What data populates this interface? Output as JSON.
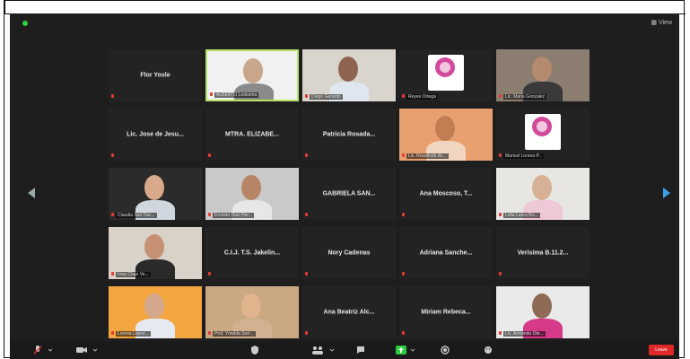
{
  "window": {
    "view_label": "View"
  },
  "nav": {
    "prev_label": "",
    "next_label": ""
  },
  "tiles": [
    {
      "name": "Flor Yosle",
      "label": "",
      "type": "name",
      "active": false
    },
    {
      "name": "",
      "label": "ALBERTO Ledesma",
      "type": "video",
      "active": true,
      "skin": "#c9a58a",
      "bg": "#f1f1f1",
      "shirt": "#8a8a8a"
    },
    {
      "name": "",
      "label": "Diego Gerardo",
      "type": "video",
      "active": false,
      "skin": "#8e6450",
      "bg": "#d9d4cc",
      "shirt": "#dfe6ef"
    },
    {
      "name": "",
      "label": "Reyes Ortega",
      "type": "logo",
      "active": false
    },
    {
      "name": "",
      "label": "Lic. Maria Gonzalez",
      "type": "video",
      "active": false,
      "skin": "#b58a6e",
      "bg": "#8c7d71",
      "shirt": "#3a3a3a"
    },
    {
      "name": "Lic. Jose de Jesu...",
      "label": "",
      "type": "name",
      "active": false
    },
    {
      "name": "MTRA. ELIZABE...",
      "label": "",
      "type": "name",
      "active": false
    },
    {
      "name": "Patricia Rosada...",
      "label": "",
      "type": "name",
      "active": false
    },
    {
      "name": "",
      "label": "Lic. Rosalinda de...",
      "type": "video",
      "active": false,
      "skin": "#c27d52",
      "bg": "#e9a070",
      "shirt": "#f0d6c0"
    },
    {
      "name": "",
      "label": "Maricel Lorena P...",
      "type": "logo",
      "active": false
    },
    {
      "name": "",
      "label": "Claudia San Osc...",
      "type": "video",
      "active": false,
      "skin": "#d8a98a",
      "bg": "#2b2b2b",
      "shirt": "#d1d7de"
    },
    {
      "name": "",
      "label": "Ernesto Diaz Her...",
      "type": "video",
      "active": false,
      "skin": "#b88466",
      "bg": "#c9c9c9",
      "shirt": "#e7e7e7"
    },
    {
      "name": "GABRIELA SAN...",
      "label": "",
      "type": "name",
      "active": false
    },
    {
      "name": "Ana Moscoso, T...",
      "label": "",
      "type": "name",
      "active": false
    },
    {
      "name": "",
      "label": "Lidia Laura Ro...",
      "type": "video",
      "active": false,
      "skin": "#d6b196",
      "bg": "#e8e6e3",
      "shirt": "#efc8d8"
    },
    {
      "name": "",
      "label": "Irma Chan Ve...",
      "type": "video",
      "active": false,
      "skin": "#c69075",
      "bg": "#d8d2c8",
      "shirt": "#2a2a2a"
    },
    {
      "name": "C.I.J. T.S. Jakelin...",
      "label": "",
      "type": "name",
      "active": false
    },
    {
      "name": "Nory Cadenas",
      "label": "",
      "type": "name",
      "active": false
    },
    {
      "name": "Adriana Sanche...",
      "label": "",
      "type": "name",
      "active": false
    },
    {
      "name": "Verisima B.11.2...",
      "label": "",
      "type": "name",
      "active": false
    },
    {
      "name": "",
      "label": "Lorena Lopez...",
      "type": "video",
      "active": false,
      "skin": "#d4a88d",
      "bg": "#f4a640",
      "shirt": "#e6eaf0"
    },
    {
      "name": "",
      "label": "Prof. Ymelda Serr...",
      "type": "video",
      "active": false,
      "skin": "#e0b48c",
      "bg": "#c9a882",
      "shirt": "#d2b090"
    },
    {
      "name": "Ana Beatriz Alc...",
      "label": "",
      "type": "name",
      "active": false
    },
    {
      "name": "Miriam Rebeca...",
      "label": "",
      "type": "name",
      "active": false
    },
    {
      "name": "",
      "label": "Lic. Armando Ole...",
      "type": "video",
      "active": false,
      "skin": "#8f6a55",
      "bg": "#eaeaea",
      "shirt": "#d83a8a"
    }
  ],
  "toolbar": {
    "end_label": "Leave"
  }
}
